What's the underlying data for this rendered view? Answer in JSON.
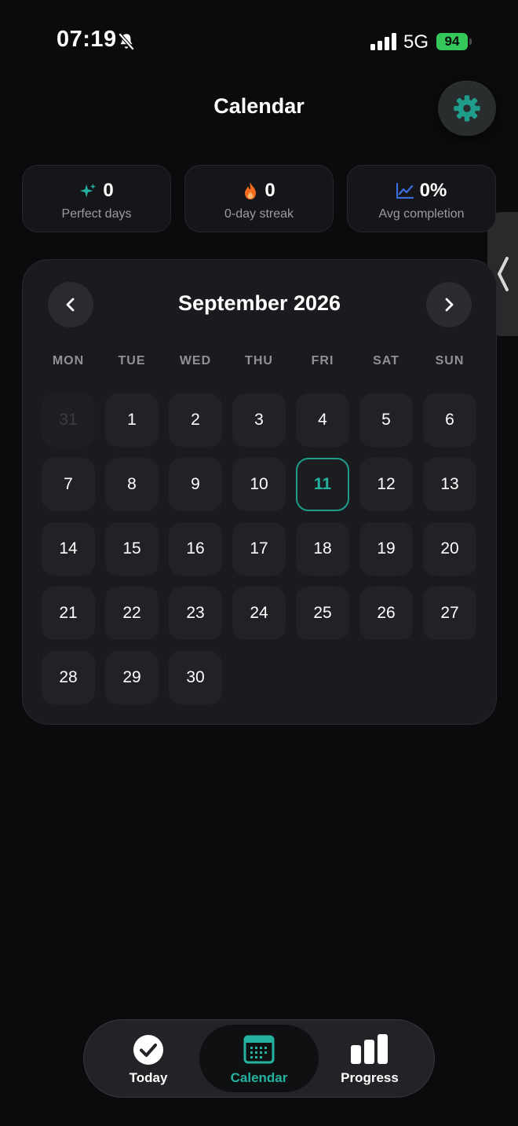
{
  "status_bar": {
    "time": "07:19",
    "network": "5G",
    "battery": "94"
  },
  "header": {
    "title": "Calendar"
  },
  "stats": [
    {
      "value": "0",
      "label": "Perfect days",
      "icon": "sparkle-icon",
      "color": "#22b3a1"
    },
    {
      "value": "0",
      "label": "0-day streak",
      "icon": "flame-icon",
      "color": "#f26b1d"
    },
    {
      "value": "0%",
      "label": "Avg completion",
      "icon": "trend-chart-icon",
      "color": "#3b6fe0"
    }
  ],
  "calendar": {
    "month_title": "September 2026",
    "weekdays": [
      "MON",
      "TUE",
      "WED",
      "THU",
      "FRI",
      "SAT",
      "SUN"
    ],
    "days": [
      "31",
      "1",
      "2",
      "3",
      "4",
      "5",
      "6",
      "7",
      "8",
      "9",
      "10",
      "11",
      "12",
      "13",
      "14",
      "15",
      "16",
      "17",
      "18",
      "19",
      "20",
      "21",
      "22",
      "23",
      "24",
      "25",
      "26",
      "27",
      "28",
      "29",
      "30"
    ],
    "outside_days": [
      "31"
    ],
    "today": "11"
  },
  "tabs": [
    {
      "label": "Today",
      "icon": "checkmark-circle-icon",
      "active": false
    },
    {
      "label": "Calendar",
      "icon": "calendar-icon",
      "active": true
    },
    {
      "label": "Progress",
      "icon": "bar-chart-icon",
      "active": false
    }
  ],
  "colors": {
    "accent": "#24b3a0",
    "background": "#0b0b0d",
    "card": "#1a1b1e",
    "battery": "#34c759"
  }
}
